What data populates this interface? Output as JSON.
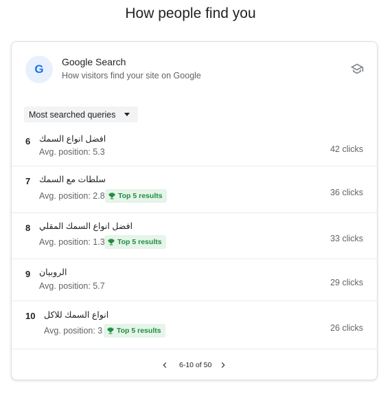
{
  "page": {
    "title": "How people find you"
  },
  "card": {
    "header": {
      "logo_letter": "G",
      "title": "Google Search",
      "subtitle": "How visitors find your site on Google",
      "icon": "graduation-cap-icon"
    },
    "dropdown": {
      "selected": "Most searched queries"
    },
    "rows": [
      {
        "rank": "6",
        "query": "افضل انواع السمك",
        "avg": "Avg. position: 5.3",
        "badge": "",
        "clicks": "42 clicks"
      },
      {
        "rank": "7",
        "query": "سلطات مع السمك",
        "avg": "Avg. position: 2.8",
        "badge": "Top 5 results",
        "clicks": "36 clicks"
      },
      {
        "rank": "8",
        "query": "افضل انواع السمك المقلي",
        "avg": "Avg. position: 1.3",
        "badge": "Top 5 results",
        "clicks": "33 clicks"
      },
      {
        "rank": "9",
        "query": "الروبيان",
        "avg": "Avg. position: 5.7",
        "badge": "",
        "clicks": "29 clicks"
      },
      {
        "rank": "10",
        "query": "انواع السمك للاكل",
        "avg": "Avg. position: 3",
        "badge": "Top 5 results",
        "clicks": "26 clicks"
      }
    ],
    "pager": {
      "range": "6-10 of 50"
    }
  },
  "colors": {
    "accent": "#1a73e8",
    "badge_bg": "#e6f4ea",
    "badge_fg": "#1e8e3e"
  }
}
